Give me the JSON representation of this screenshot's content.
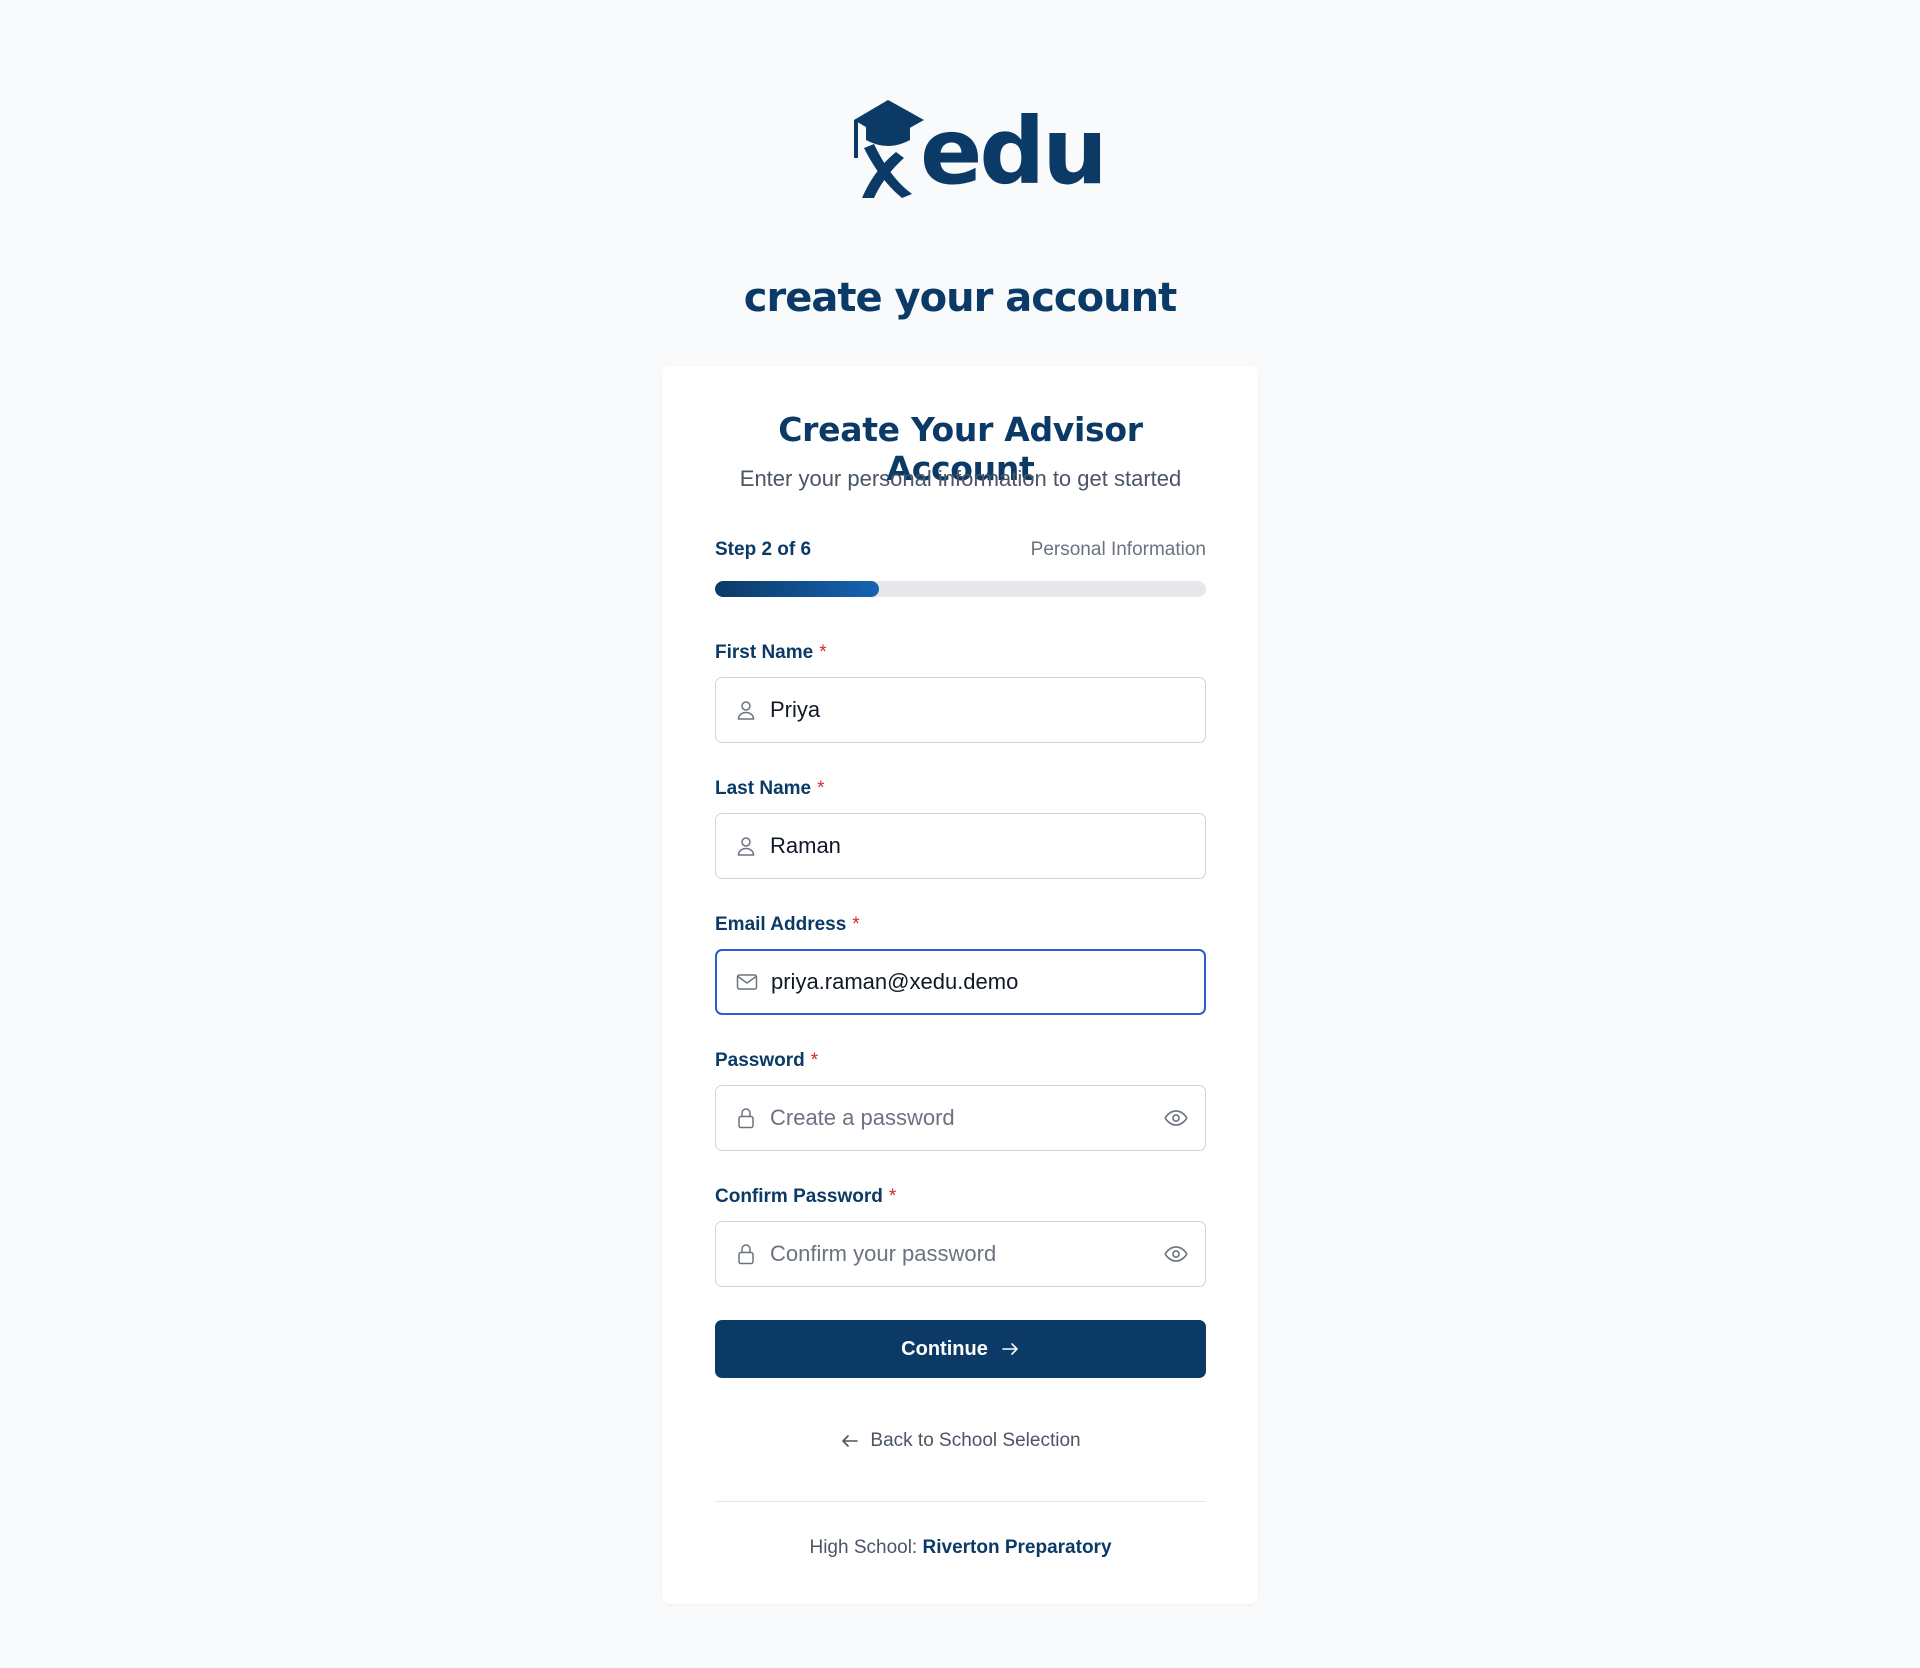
{
  "brand": {
    "name": "edu",
    "primary_color": "#0b3a66",
    "accent_color": "#2d5bd7",
    "required_color": "#dc2626"
  },
  "page_title": "create your account",
  "card": {
    "title": "Create Your Advisor Account",
    "subtitle": "Enter your personal information to get started"
  },
  "progress": {
    "step_label": "Step 2 of 6",
    "step_name": "Personal Information",
    "fraction": 0.333
  },
  "form": {
    "required_marker": "*",
    "first_name": {
      "label": "First Name",
      "value": "Priya",
      "icon": "user-icon"
    },
    "last_name": {
      "label": "Last Name",
      "value": "Raman",
      "icon": "user-icon"
    },
    "email": {
      "label": "Email Address",
      "value": "priya.raman@xedu.demo",
      "icon": "mail-icon",
      "focused": true
    },
    "password": {
      "label": "Password",
      "placeholder": "Create a password",
      "icon": "lock-icon"
    },
    "confirm_password": {
      "label": "Confirm Password",
      "placeholder": "Confirm your password",
      "icon": "lock-icon"
    }
  },
  "actions": {
    "continue_label": "Continue",
    "back_label": "Back to School Selection"
  },
  "footer": {
    "school_prefix": "High School:",
    "school_name": "Riverton Preparatory"
  }
}
